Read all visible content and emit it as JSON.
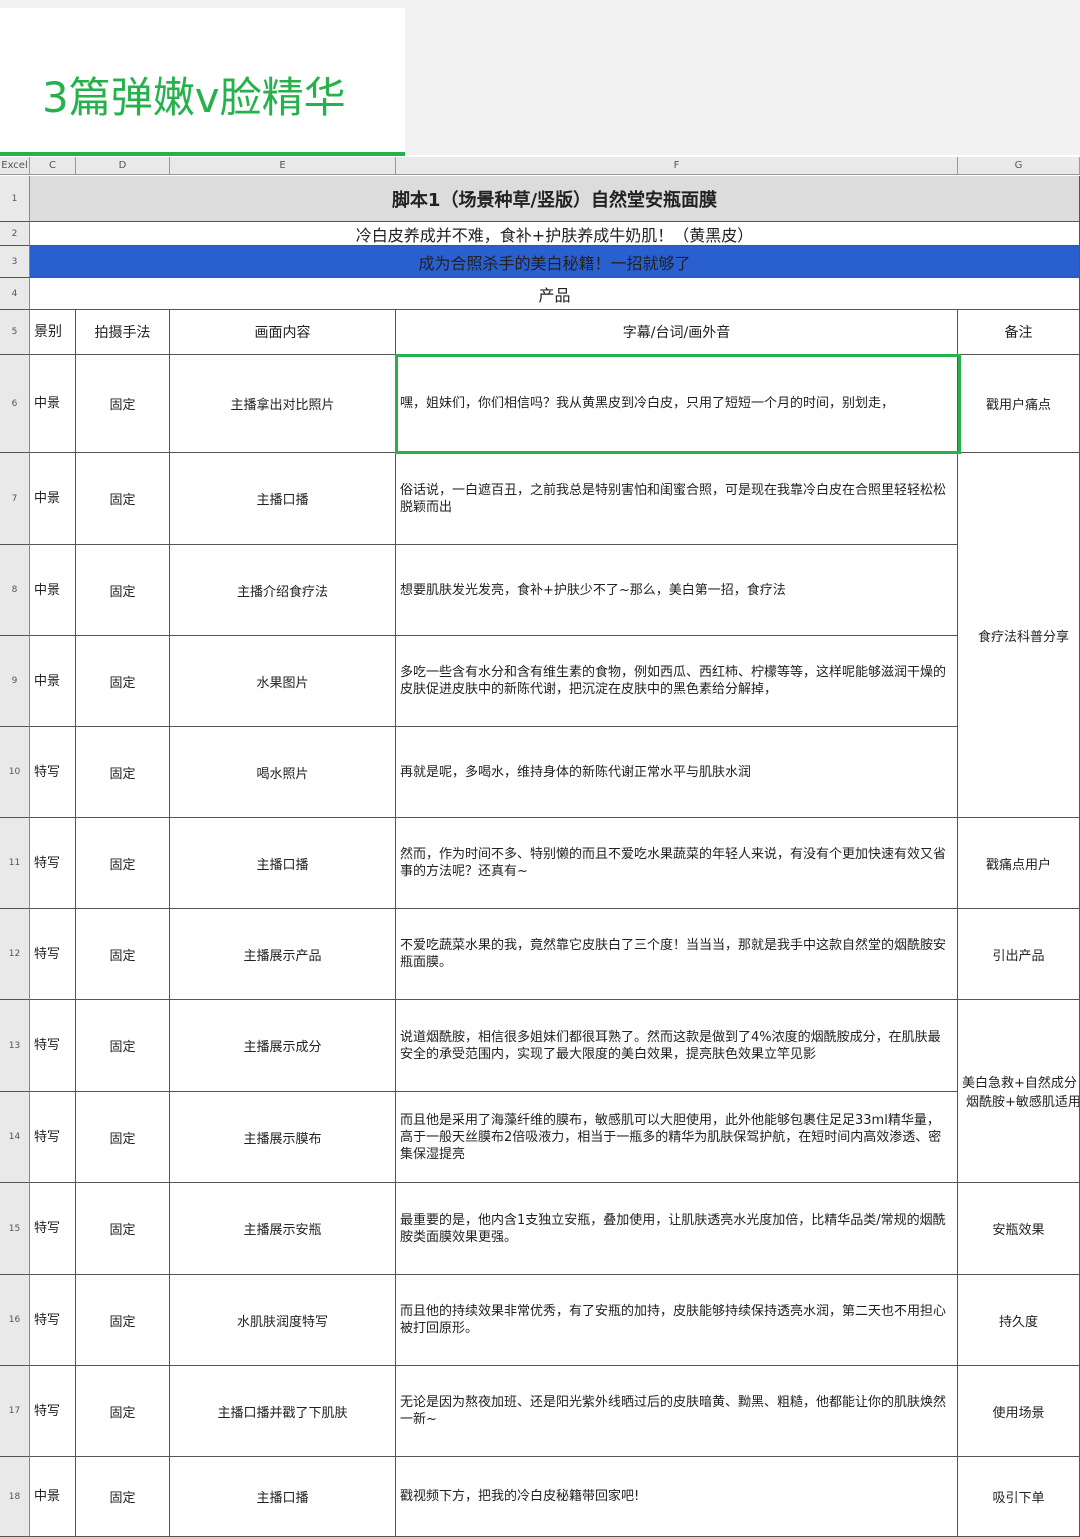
{
  "document_title": "3篇弹嫩v脸精华",
  "sheet": {
    "app_label": "Excel",
    "columns": [
      "C",
      "D",
      "E",
      "F",
      "G"
    ],
    "title_row": {
      "num": "1",
      "text": "脚本1（场景种草/竖版）自然堂安瓶面膜"
    },
    "subtitle_row": {
      "num": "2",
      "text": "冷白皮养成并不难，食补+护肤养成牛奶肌！（黄黑皮）"
    },
    "banner_row": {
      "num": "3",
      "text": "成为合照杀手的美白秘籍！一招就够了"
    },
    "product_row": {
      "num": "4",
      "text": "产品"
    },
    "header_row": {
      "num": "5",
      "c": "景别",
      "d": "拍摄手法",
      "e": "画面内容",
      "f": "字幕/台词/画外音",
      "g": "备注"
    },
    "rows": [
      {
        "num": "6",
        "c": "中景",
        "d": "固定",
        "e": "主播拿出对比照片",
        "f": "嘿，姐妹们，你们相信吗？我从黄黑皮到冷白皮，只用了短短一个月的时间，别划走，",
        "g": "戳用户痛点"
      },
      {
        "num": "7",
        "c": "中景",
        "d": "固定",
        "e": "主播口播",
        "f": "俗话说，一白遮百丑，之前我总是特别害怕和闺蜜合照，可是现在我靠冷白皮在合照里轻轻松松脱颖而出"
      },
      {
        "num": "8",
        "c": "中景",
        "d": "固定",
        "e": "主播介绍食疗法",
        "f": "想要肌肤发光发亮，食补+护肤少不了~那么，美白第一招，食疗法"
      },
      {
        "num": "9",
        "c": "中景",
        "d": "固定",
        "e": "水果图片",
        "f": "多吃一些含有水分和含有维生素的食物，例如西瓜、西红柿、柠檬等等，这样呢能够滋润干燥的皮肤促进皮肤中的新陈代谢，把沉淀在皮肤中的黑色素给分解掉，"
      },
      {
        "num": "10",
        "c": "特写",
        "d": "固定",
        "e": "喝水照片",
        "f": "再就是呢，多喝水，维持身体的新陈代谢正常水平与肌肤水润"
      },
      {
        "num": "11",
        "c": "特写",
        "d": "固定",
        "e": "主播口播",
        "f": "然而，作为时间不多、特别懒的而且不爱吃水果蔬菜的年轻人来说，有没有个更加快速有效又省事的方法呢？还真有~",
        "g": "戳痛点用户"
      },
      {
        "num": "12",
        "c": "特写",
        "d": "固定",
        "e": "主播展示产品",
        "f": "不爱吃蔬菜水果的我，竟然靠它皮肤白了三个度！当当当，那就是我手中这款自然堂的烟酰胺安瓶面膜。",
        "g": "引出产品"
      },
      {
        "num": "13",
        "c": "特写",
        "d": "固定",
        "e": "主播展示成分",
        "f": "说道烟酰胺，相信很多姐妹们都很耳熟了。然而这款是做到了4%浓度的烟酰胺成分，在肌肤最安全的承受范围内，实现了最大限度的美白效果，提亮肤色效果立竿见影"
      },
      {
        "num": "14",
        "c": "特写",
        "d": "固定",
        "e": "主播展示膜布",
        "f": "而且他是采用了海藻纤维的膜布，敏感肌可以大胆使用，此外他能够包裹住足足33ml精华量，高于一般天丝膜布2倍吸液力，相当于一瓶多的精华为肌肤保驾护航，在短时间内高效渗透、密集保湿提亮"
      },
      {
        "num": "15",
        "c": "特写",
        "d": "固定",
        "e": "主播展示安瓶",
        "f": "最重要的是，他内含1支独立安瓶，叠加使用，让肌肤透亮水光度加倍，比精华品类/常规的烟酰胺类面膜效果更强。",
        "g": "安瓶效果"
      },
      {
        "num": "16",
        "c": "特写",
        "d": "固定",
        "e": "水肌肤润度特写",
        "f": "而且他的持续效果非常优秀，有了安瓶的加持，皮肤能够持续保持透亮水润，第二天也不用担心被打回原形。",
        "g": "持久度"
      },
      {
        "num": "17",
        "c": "特写",
        "d": "固定",
        "e": "主播口播并戳了下肌肤",
        "f": "无论是因为熬夜加班、还是阳光紫外线晒过后的皮肤暗黄、黝黑、粗糙，他都能让你的肌肤焕然一新~",
        "g": "使用场景"
      },
      {
        "num": "18",
        "c": "中景",
        "d": "固定",
        "e": "主播口播",
        "f": "戳视频下方，把我的冷白皮秘籍带回家吧!",
        "g": "吸引下单"
      }
    ],
    "merged_notes": {
      "rows_7_10": "食疗法科普分享",
      "rows_13_14_line1": "美白急救+自然成分",
      "rows_13_14_line2": "烟酰胺+敏感肌适用"
    },
    "colors": {
      "accent_green": "#27b14d",
      "banner_blue": "#2a5fd0",
      "title_gray": "#dcdcdc"
    }
  }
}
